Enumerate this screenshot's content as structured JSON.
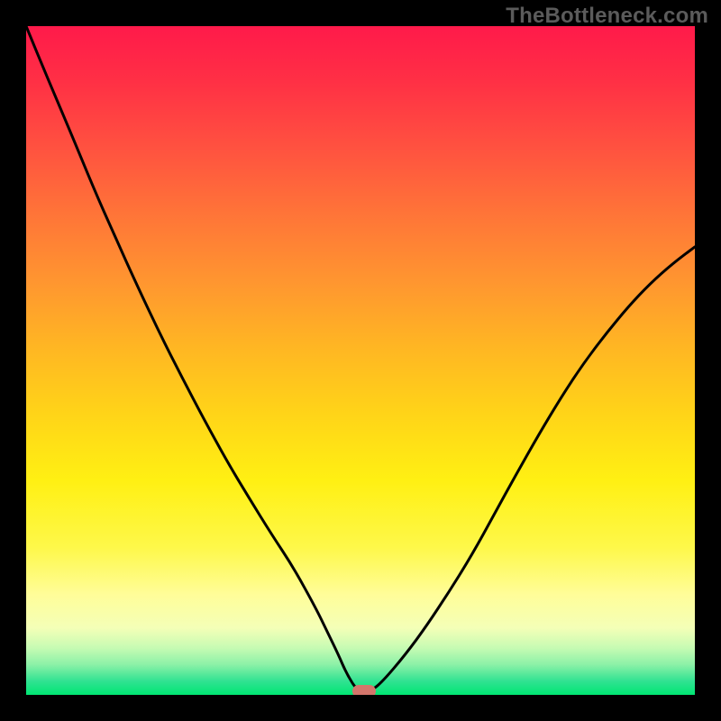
{
  "watermark": "TheBottleneck.com",
  "colors": {
    "frame": "#000000",
    "curve": "#000000",
    "marker": "#d3756b"
  },
  "chart_data": {
    "type": "line",
    "title": "",
    "xlabel": "",
    "ylabel": "",
    "xlim": [
      0,
      100
    ],
    "ylim": [
      0,
      100
    ],
    "grid": false,
    "note": "No axis ticks or numeric labels are rendered; values are pixel-read estimates of the bottleneck curve on a 0–100 normalized scale.",
    "series": [
      {
        "name": "bottleneck-curve",
        "x": [
          0.0,
          3.3,
          6.7,
          10.0,
          13.3,
          16.7,
          20.0,
          23.3,
          26.7,
          30.0,
          33.3,
          36.7,
          40.0,
          43.3,
          45.0,
          46.7,
          48.0,
          49.6,
          51.5,
          53.3,
          56.7,
          60.0,
          63.3,
          66.7,
          70.0,
          73.3,
          76.7,
          80.0,
          83.3,
          86.7,
          90.0,
          93.3,
          96.7,
          100.0
        ],
        "y": [
          100.0,
          92.0,
          84.0,
          76.0,
          68.5,
          61.0,
          54.0,
          47.5,
          41.0,
          35.0,
          29.5,
          24.0,
          19.0,
          13.0,
          9.5,
          6.0,
          3.0,
          0.5,
          0.5,
          2.0,
          6.0,
          10.5,
          15.5,
          21.0,
          27.0,
          33.0,
          39.0,
          44.5,
          49.5,
          54.0,
          58.0,
          61.5,
          64.5,
          67.0
        ]
      }
    ],
    "marker": {
      "x": 50.5,
      "y": 0.5
    }
  }
}
